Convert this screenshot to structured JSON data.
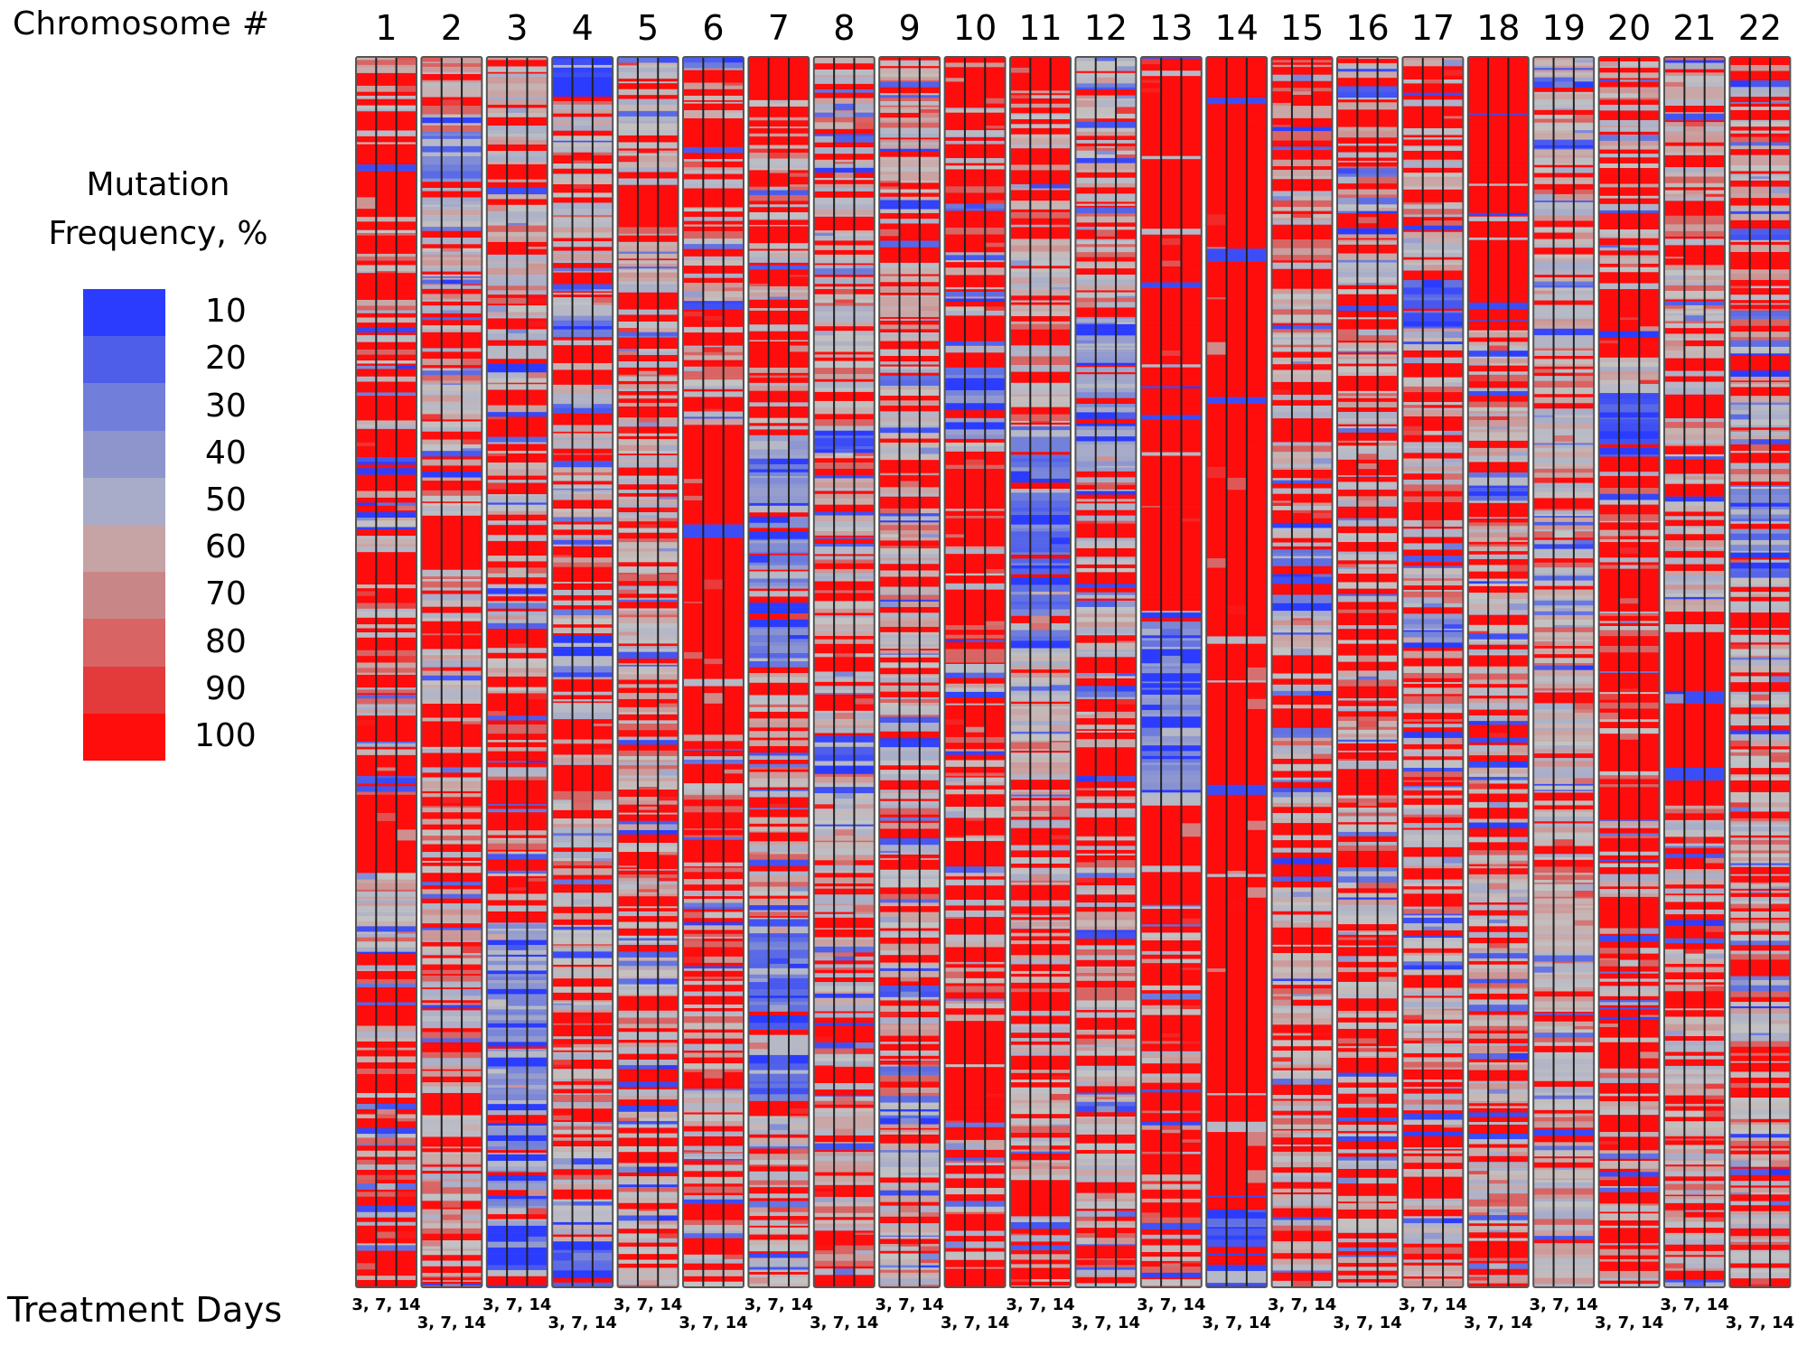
{
  "chart_data": {
    "type": "heatmap",
    "title": "",
    "xlabel": "Chromosome #",
    "bottom_label": "Treatment Days",
    "legend": {
      "title_line1": "Mutation",
      "title_line2": "Frequency, %",
      "placement": "left",
      "ticks": [
        "10",
        "20",
        "30",
        "40",
        "50",
        "60",
        "70",
        "80",
        "90",
        "100"
      ],
      "colors": [
        "#2b3cff",
        "#4f5ee8",
        "#717fdb",
        "#8d95cc",
        "#a8acc8",
        "#c3c3c3",
        "#c6a3a5",
        "#c98687",
        "#d96464",
        "#e33b3b",
        "#ff0c0c"
      ]
    },
    "chromosomes": [
      "1",
      "2",
      "3",
      "4",
      "5",
      "6",
      "7",
      "8",
      "9",
      "10",
      "11",
      "12",
      "13",
      "14",
      "15",
      "16",
      "17",
      "18",
      "19",
      "20",
      "21",
      "22"
    ],
    "treatment_days": [
      "3, 7, 14"
    ],
    "days_per_chromosome": [
      3,
      7,
      14
    ],
    "value_range": [
      10,
      100
    ],
    "profiles": [
      {
        "chrom": "1",
        "segments": [
          [
            0,
            0.08,
            85
          ],
          [
            0.08,
            0.13,
            100
          ],
          [
            0.13,
            0.6,
            88
          ],
          [
            0.6,
            0.66,
            98
          ],
          [
            0.66,
            0.72,
            62
          ],
          [
            0.72,
            1,
            82
          ]
        ]
      },
      {
        "chrom": "2",
        "segments": [
          [
            0,
            0.06,
            75
          ],
          [
            0.06,
            0.1,
            30
          ],
          [
            0.1,
            0.37,
            70
          ],
          [
            0.37,
            0.41,
            95
          ],
          [
            0.41,
            1,
            72
          ]
        ]
      },
      {
        "chrom": "3",
        "segments": [
          [
            0,
            0.23,
            72
          ],
          [
            0.23,
            0.25,
            20
          ],
          [
            0.25,
            0.7,
            75
          ],
          [
            0.7,
            0.97,
            40
          ],
          [
            0.97,
            1,
            15
          ]
        ]
      },
      {
        "chrom": "4",
        "segments": [
          [
            0,
            0.03,
            20
          ],
          [
            0.03,
            0.2,
            68
          ],
          [
            0.2,
            0.23,
            30
          ],
          [
            0.23,
            0.47,
            75
          ],
          [
            0.47,
            0.5,
            25
          ],
          [
            0.5,
            0.96,
            70
          ],
          [
            0.96,
            1,
            25
          ]
        ]
      },
      {
        "chrom": "5",
        "segments": [
          [
            0,
            0.1,
            60
          ],
          [
            0.1,
            0.13,
            100
          ],
          [
            0.13,
            1,
            70
          ]
        ]
      },
      {
        "chrom": "6",
        "segments": [
          [
            0,
            0.2,
            72
          ],
          [
            0.2,
            0.3,
            75
          ],
          [
            0.3,
            0.55,
            98
          ],
          [
            0.55,
            0.8,
            82
          ],
          [
            0.8,
            1,
            80
          ]
        ]
      },
      {
        "chrom": "7",
        "segments": [
          [
            0,
            0.3,
            78
          ],
          [
            0.3,
            0.48,
            38
          ],
          [
            0.48,
            0.7,
            72
          ],
          [
            0.7,
            0.85,
            25
          ],
          [
            0.85,
            0.95,
            75
          ],
          [
            0.95,
            1,
            60
          ]
        ]
      },
      {
        "chrom": "8",
        "segments": [
          [
            0,
            0.3,
            70
          ],
          [
            0.3,
            0.32,
            15
          ],
          [
            0.32,
            0.55,
            75
          ],
          [
            0.55,
            0.58,
            20
          ],
          [
            0.58,
            0.85,
            65
          ],
          [
            0.85,
            1,
            72
          ]
        ]
      },
      {
        "chrom": "9",
        "segments": [
          [
            0,
            1,
            70
          ]
        ]
      },
      {
        "chrom": "10",
        "segments": [
          [
            0,
            0.25,
            88
          ],
          [
            0.25,
            0.31,
            35
          ],
          [
            0.31,
            1,
            88
          ]
        ]
      },
      {
        "chrom": "11",
        "segments": [
          [
            0,
            0.3,
            75
          ],
          [
            0.3,
            0.48,
            30
          ],
          [
            0.48,
            0.6,
            55
          ],
          [
            0.6,
            1,
            78
          ]
        ]
      },
      {
        "chrom": "12",
        "segments": [
          [
            0,
            0.2,
            70
          ],
          [
            0.2,
            0.34,
            40
          ],
          [
            0.34,
            0.8,
            72
          ],
          [
            0.8,
            1,
            65
          ]
        ]
      },
      {
        "chrom": "13",
        "segments": [
          [
            0,
            0.45,
            92
          ],
          [
            0.45,
            0.6,
            35
          ],
          [
            0.6,
            0.68,
            95
          ],
          [
            0.68,
            0.8,
            88
          ],
          [
            0.8,
            1,
            85
          ]
        ]
      },
      {
        "chrom": "14",
        "segments": [
          [
            0,
            0.93,
            98
          ],
          [
            0.93,
            1,
            20
          ]
        ]
      },
      {
        "chrom": "15",
        "segments": [
          [
            0,
            0.08,
            90
          ],
          [
            0.08,
            0.4,
            70
          ],
          [
            0.4,
            0.45,
            25
          ],
          [
            0.45,
            1,
            72
          ]
        ]
      },
      {
        "chrom": "16",
        "segments": [
          [
            0,
            1,
            78
          ]
        ]
      },
      {
        "chrom": "17",
        "segments": [
          [
            0,
            0.18,
            72
          ],
          [
            0.18,
            0.22,
            20
          ],
          [
            0.22,
            0.45,
            74
          ],
          [
            0.45,
            0.48,
            40
          ],
          [
            0.48,
            1,
            72
          ]
        ]
      },
      {
        "chrom": "18",
        "segments": [
          [
            0,
            0.22,
            92
          ],
          [
            0.22,
            0.33,
            60
          ],
          [
            0.33,
            0.36,
            20
          ],
          [
            0.36,
            0.78,
            74
          ],
          [
            0.78,
            1,
            72
          ]
        ]
      },
      {
        "chrom": "19",
        "segments": [
          [
            0,
            1,
            60
          ]
        ]
      },
      {
        "chrom": "20",
        "segments": [
          [
            0,
            0.28,
            80
          ],
          [
            0.28,
            0.33,
            25
          ],
          [
            0.33,
            0.8,
            88
          ],
          [
            0.8,
            1,
            80
          ]
        ]
      },
      {
        "chrom": "21",
        "segments": [
          [
            0,
            0.45,
            72
          ],
          [
            0.45,
            0.6,
            95
          ],
          [
            0.6,
            1,
            75
          ]
        ]
      },
      {
        "chrom": "22",
        "segments": [
          [
            0,
            0.35,
            75
          ],
          [
            0.35,
            0.42,
            30
          ],
          [
            0.42,
            1,
            68
          ]
        ]
      }
    ]
  }
}
